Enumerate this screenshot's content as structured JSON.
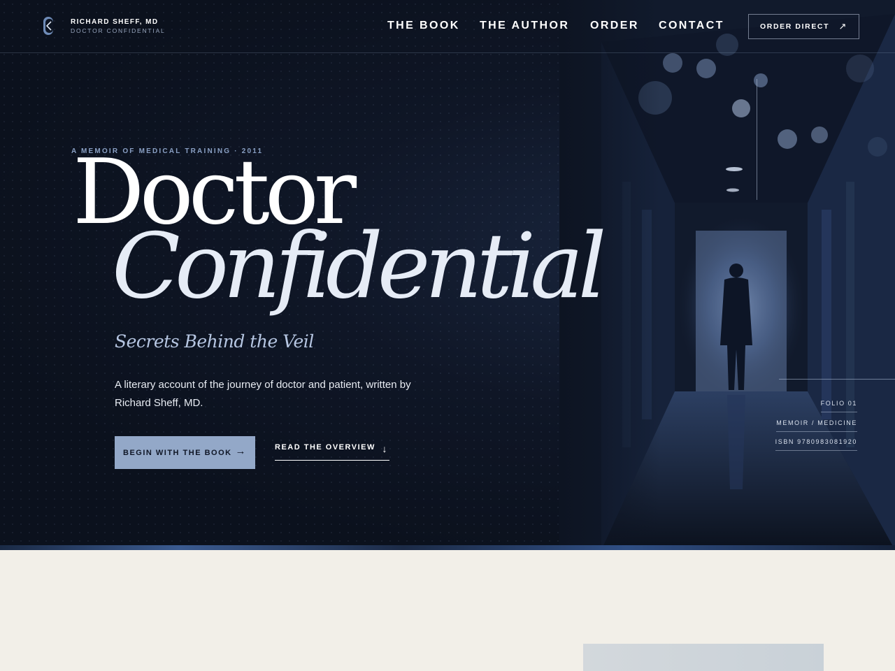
{
  "header": {
    "brand_name": "RICHARD SHEFF, MD",
    "brand_sub": "DOCTOR CONFIDENTIAL",
    "nav": [
      {
        "label": "THE BOOK"
      },
      {
        "label": "THE AUTHOR"
      },
      {
        "label": "ORDER"
      },
      {
        "label": "CONTACT"
      }
    ],
    "cta_label": "ORDER DIRECT",
    "cta_icon": "arrow-up-right-icon"
  },
  "hero": {
    "eyebrow": "A MEMOIR OF MEDICAL TRAINING · 2011",
    "title_line1": "Doctor",
    "title_line2": "Confidential",
    "subtitle": "Secrets Behind the Veil",
    "description": "A literary account of the journey of doctor and patient, written by Richard Sheff, MD.",
    "primary_button": "BEGIN WITH THE BOOK",
    "primary_icon": "arrow-right-icon",
    "secondary_button": "READ THE OVERVIEW",
    "secondary_icon": "arrow-down-icon"
  },
  "meta": [
    {
      "label": "FOLIO 01"
    },
    {
      "label": "MEMOIR / MEDICINE"
    },
    {
      "label": "ISBN 9780983081920"
    }
  ],
  "colors": {
    "hero_bg": "#0b111d",
    "accent": "#93a8c8",
    "cream": "#f2efe8",
    "text_light": "#ffffff"
  }
}
